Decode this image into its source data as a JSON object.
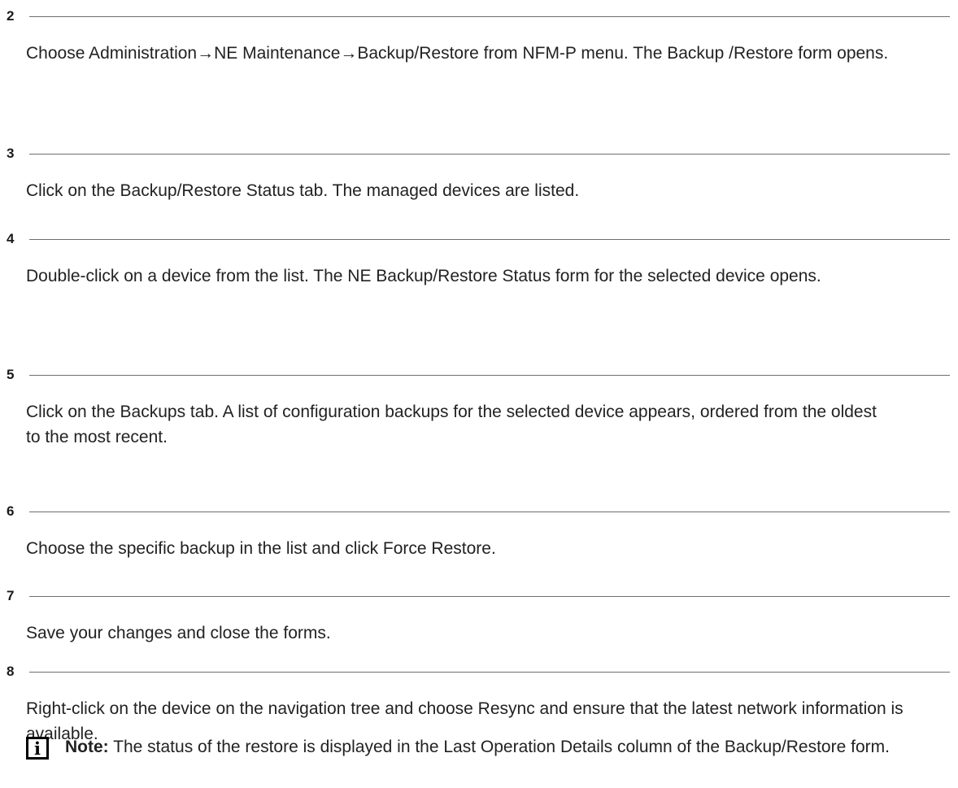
{
  "steps": [
    {
      "number": "2",
      "text": "Choose Administration→NE Maintenance→Backup/Restore from NFM-P menu. The Backup /Restore form opens."
    },
    {
      "number": "3",
      "text": "Click on the Backup/Restore Status tab. The managed devices are listed."
    },
    {
      "number": "4",
      "text": "Double-click on a device from the list. The NE Backup/Restore Status form for the selected device opens."
    },
    {
      "number": "5",
      "text": "Click on the Backups tab. A list of configuration backups for the selected device appears, ordered from the oldest to the most recent."
    },
    {
      "number": "6",
      "text": "Choose the specific backup in the list and click Force Restore."
    },
    {
      "number": "7",
      "text": "Save your changes and close the forms."
    },
    {
      "number": "8",
      "text": "Right-click on the device on the navigation tree and choose Resync and ensure that the latest network information is available."
    }
  ],
  "note": {
    "icon": "info-icon",
    "icon_glyph": "i",
    "label": "Note:",
    "text": "The status of the restore is displayed in the Last Operation Details column of the Backup/Restore form."
  }
}
